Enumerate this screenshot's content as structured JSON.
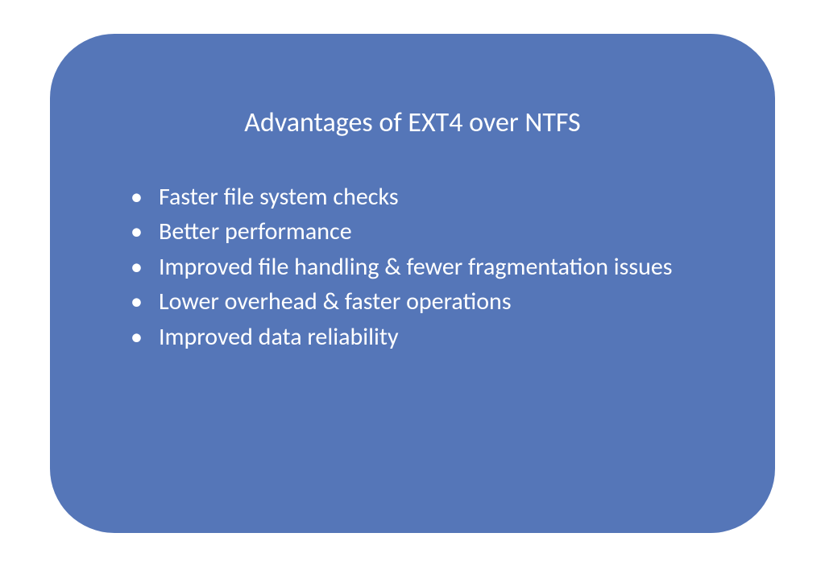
{
  "slide": {
    "title": "Advantages of EXT4 over NTFS",
    "bullets": [
      "Faster file system checks",
      "Better performance",
      "Improved file handling & fewer fragmentation issues",
      "Lower overhead & faster operations",
      "Improved data reliability"
    ]
  }
}
